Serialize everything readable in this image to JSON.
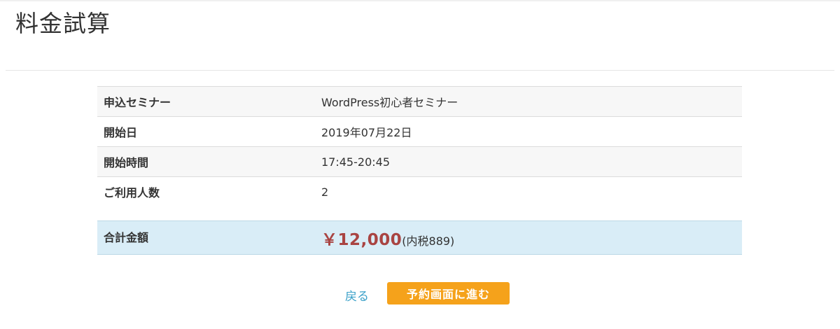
{
  "page": {
    "title": "料金試算"
  },
  "details": {
    "rows": [
      {
        "label": "申込セミナー",
        "value": "WordPress初心者セミナー"
      },
      {
        "label": "開始日",
        "value": "2019年07月22日"
      },
      {
        "label": "開始時間",
        "value": "17:45-20:45"
      },
      {
        "label": "ご利用人数",
        "value": "2"
      }
    ]
  },
  "total": {
    "label": "合計金額",
    "amount": "￥12,000",
    "tax_note": "(内税889)"
  },
  "actions": {
    "back_label": "戻る",
    "proceed_label": "予約画面に進む"
  },
  "colors": {
    "accent_button": "#f5a21b",
    "link": "#3aa0c8",
    "total_row_bg": "#d9edf7",
    "amount_text": "#a94442"
  }
}
